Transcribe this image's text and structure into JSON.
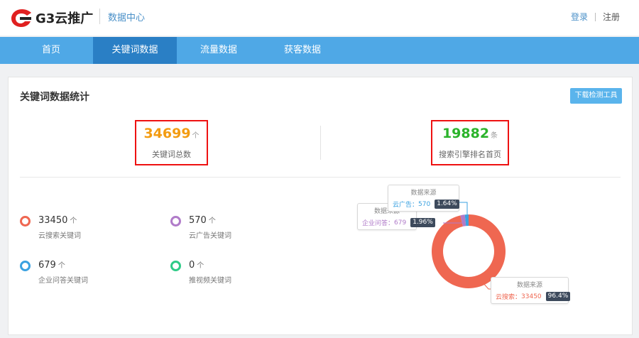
{
  "header": {
    "logo_text": "G3云推广",
    "subtitle": "数据中心",
    "login": "登录",
    "register": "注册"
  },
  "nav": {
    "items": [
      {
        "label": "首页"
      },
      {
        "label": "关键词数据"
      },
      {
        "label": "流量数据"
      },
      {
        "label": "获客数据"
      }
    ],
    "active_index": 1
  },
  "card": {
    "title": "关键词数据统计",
    "download_button": "下载检测工具",
    "total": {
      "value": "34699",
      "unit": "个",
      "label": "关键词总数"
    },
    "ranking": {
      "value": "19882",
      "unit": "条",
      "label": "搜索引擎排名首页"
    },
    "legend": [
      {
        "value": "33450",
        "unit": "个",
        "label": "云搜索关键词",
        "color": "#ef6751"
      },
      {
        "value": "570",
        "unit": "个",
        "label": "云广告关键词",
        "color": "#b07bc9"
      },
      {
        "value": "679",
        "unit": "个",
        "label": "企业问答关键词",
        "color": "#3aa1e0"
      },
      {
        "value": "0",
        "unit": "个",
        "label": "推视频关键词",
        "color": "#2ecb87"
      }
    ]
  },
  "chart_data": {
    "type": "pie",
    "donut": true,
    "slices": [
      {
        "name": "云搜索",
        "value": 33450,
        "percent": "96.4%",
        "color": "#ef6751"
      },
      {
        "name": "企业问答",
        "value": 679,
        "percent": "1.96%",
        "color": "#b07bc9"
      },
      {
        "name": "云广告",
        "value": 570,
        "percent": "1.64%",
        "color": "#3aa1e0"
      }
    ],
    "tooltip_title": "数据来源"
  },
  "colors": {
    "nav_bg": "#4fa8e6",
    "nav_active": "#2a7fc5",
    "total_color": "#f39c12",
    "ranking_color": "#2bb32b",
    "highlight_box": "#e11111"
  }
}
